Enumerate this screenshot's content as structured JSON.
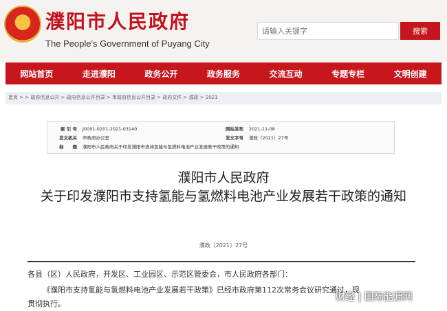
{
  "header": {
    "title": "濮阳市人民政府",
    "subtitle": "The People's Government of Puyang City",
    "search_placeholder": "请输入关键字",
    "search_button": "搜索"
  },
  "nav": [
    "网站首页",
    "走进濮阳",
    "政务公开",
    "政务服务",
    "交流互动",
    "专题专栏",
    "文明创建"
  ],
  "breadcrumb": "首页 > > 政府信息公开 > 政府信息公开目录 > 市政府信息公开目录 > 政府文件 > 濮政 > 2021",
  "meta": {
    "index_label": "索 引 号",
    "index_value": "J0001-0201-2021-03140",
    "date_label": "网站发布",
    "date_value": "2021-11-08",
    "org_label": "发文机关",
    "org_value": "市政府办公室",
    "num_label": "发文字号",
    "num_value": "濮政〔2021〕27号",
    "subject_label": "标　　题",
    "subject_value": "濮阳市人民政府关于印发濮阳市支持氢能与氢燃料电池产业发展若干政策的通知"
  },
  "doc": {
    "title_line1": "濮阳市人民政府",
    "title_line2": "关于印发濮阳市支持氢能与氢燃料电池产业发展若干政策的通知",
    "number": "濮政〔2021〕27号",
    "salutation": "各县（区）人民政府，开发区、工业园区、示范区管委会，市人民政府各部门：",
    "body_start": "《濮阳市支持氢能与氢燃料电池产业发展若干政策》已经市政府第112次常务会议研究通过，现",
    "body_end": "贯彻执行。"
  },
  "watermark": "财经 | 国际能源网"
}
